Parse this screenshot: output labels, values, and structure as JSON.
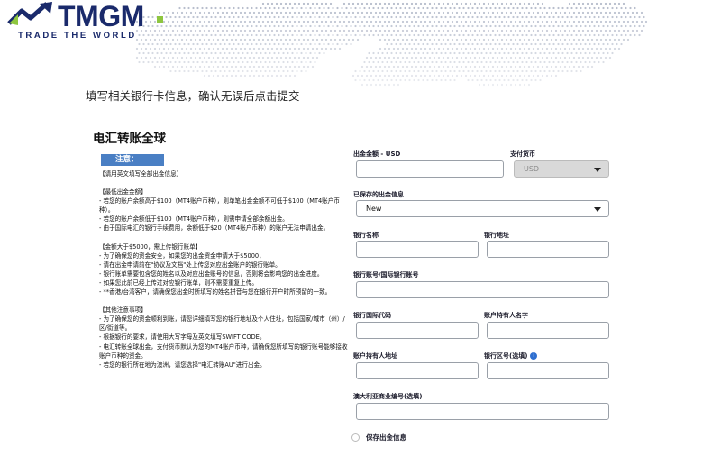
{
  "brand": {
    "name": "TMGM",
    "tagline": "TRADE THE WORLD",
    "primary_color": "#1a2a6b",
    "accent_color": "#8ec63f"
  },
  "header": {
    "subtitle": "填写相关银行卡信息，确认无误后点击提交"
  },
  "page": {
    "title": "电汇转账全球"
  },
  "notice": {
    "badge": "注意：",
    "paragraphs": [
      [
        "【请用英文填写全部出金信息】"
      ],
      [
        "【最低出金金额】",
        "- 若您的账户余额高于$100（MT4账户币种），则单笔出金金额不可低于$100（MT4账户币种）。",
        "- 若您的账户余额低于$100（MT4账户币种），则需申请全部余额出金。",
        "- 由于国际电汇的银行手续费用，余额低于$20（MT4账户币种）的账户无法申请出金。"
      ],
      [
        "【金额大于$5000，需上传银行账单】",
        "- 为了确保您的资金安全，如果您的出金资金申请大于$5000，",
        "- 请在出金申请前在\"协议及文档\"处上传您对应出金账户的银行账单。",
        "- 银行账单需要包含您的姓名以及对应出金账号的信息，否则将会影响您的出金进度。",
        "- 如果您此前已经上传过对应银行账单，则不需要重复上传。",
        "- **香港/台湾客户，请确保您出金时所填写的姓名拼音与您在银行开户时所预留的一致。"
      ],
      [
        "【其他注意事项】",
        "- 为了确保您的资金顺利到账，请您详细填写您的银行地址及个人住址，包括国家/城市（州）/区/街道等。",
        "- 根据银行的要求，请使用大写字母及英文填写SWIFT CODE。",
        "- 电汇转账全球出金，支付货币默认为您的MT4账户币种，请确保您所填写的银行账号能够接收账户币种的资金。",
        "- 若您的银行所在地为澳洲，请您选择\"电汇转账AU\"进行出金。"
      ]
    ]
  },
  "form": {
    "withdraw_amount_label": "出金金额 - USD",
    "currency_label": "支付货币",
    "currency_value": "USD",
    "saved_info_label": "已保存的出金信息",
    "saved_info_value": "New",
    "bank_name_label": "银行名称",
    "bank_address_label": "银行地址",
    "account_number_label": "银行账号/国际银行账号",
    "swift_label": "银行国际代码",
    "holder_name_label": "账户持有人名字",
    "holder_address_label": "账户持有人地址",
    "branch_label": "银行区号(选填)",
    "abn_label": "澳大利亚商业编号(选填)",
    "save_label": "保存出金信息",
    "info_icon": "i"
  }
}
